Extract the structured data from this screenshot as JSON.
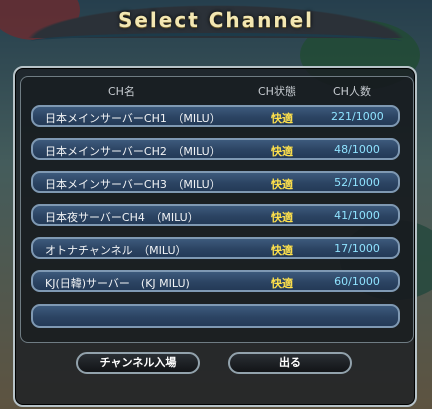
{
  "window": {
    "title": "Select  Channel"
  },
  "table": {
    "headers": {
      "name": "CH名",
      "state": "CH状態",
      "count": "CH人数"
    },
    "rows": [
      {
        "name": "日本メインサーバーCH1　（MILU）",
        "state": "快適",
        "count": "221/1000"
      },
      {
        "name": "日本メインサーバーCH2　（MILU）",
        "state": "快適",
        "count": "48/1000"
      },
      {
        "name": "日本メインサーバーCH3　（MILU）",
        "state": "快適",
        "count": "52/1000"
      },
      {
        "name": "日本夜サーバーCH4　（MILU）",
        "state": "快適",
        "count": "41/1000"
      },
      {
        "name": "オトナチャンネル　（MILU）",
        "state": "快適",
        "count": "17/1000"
      },
      {
        "name": "KJ(日韓)サーバー　(KJ MILU)",
        "state": "快適",
        "count": "60/1000"
      }
    ]
  },
  "buttons": {
    "enter": "チャンネル入場",
    "exit": "出る"
  },
  "colors": {
    "status_good": "#ffe14b",
    "count": "#8fe3ff",
    "row_fill": "#2c4463",
    "title": "#f3e7b2"
  }
}
